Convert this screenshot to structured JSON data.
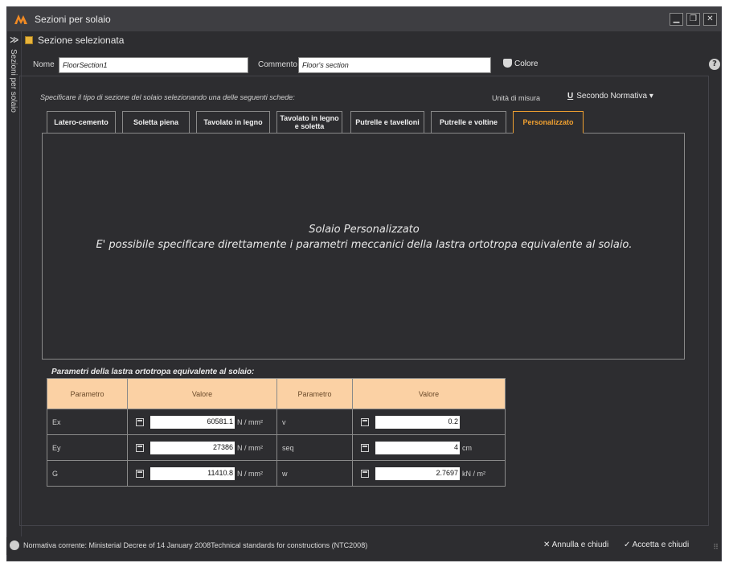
{
  "window": {
    "title": "Sezioni per solaio",
    "minimize": "▁",
    "restore": "❐",
    "close": "✕"
  },
  "sidebar": {
    "label": "Sezioni per solaio",
    "chevron": "≫"
  },
  "section": {
    "title": "Sezione selezionata",
    "name_label": "Nome",
    "name_value": "FloorSection1",
    "comment_label": "Commento",
    "comment_value": "Floor's section",
    "color_label": "Colore",
    "help": "?"
  },
  "instructions": "Specificare il tipo di sezione del solaio selezionando una delle seguenti schede:",
  "units": {
    "label": "Unità di misura",
    "icon_letter": "U",
    "value": "Secondo Normativa",
    "caret": "▾"
  },
  "tabs": [
    {
      "label": "Latero-cemento"
    },
    {
      "label": "Soletta piena"
    },
    {
      "label": "Tavolato in legno"
    },
    {
      "label": "Tavolato in legno e soletta"
    },
    {
      "label": "Putrelle e tavelloni"
    },
    {
      "label": "Putrelle e voltine"
    },
    {
      "label": "Personalizzato"
    }
  ],
  "active_tab": "Personalizzato",
  "custom": {
    "title": "Solaio Personalizzato",
    "description": "E' possibile specificare direttamente i parametri meccanici della lastra ortotropa equivalente al solaio."
  },
  "params": {
    "title": "Parametri della lastra ortotropa equivalente al solaio:",
    "headers": [
      "Parametro",
      "Valore",
      "Parametro",
      "Valore"
    ],
    "rows": [
      {
        "p1": "Ex",
        "v1": "60581.1",
        "u1": "N / mm²",
        "p2": "v",
        "v2": "0.2",
        "u2": ""
      },
      {
        "p1": "Ey",
        "v1": "27386",
        "u1": "N / mm²",
        "p2": "seq",
        "v2": "4",
        "u2": "cm"
      },
      {
        "p1": "G",
        "v1": "11410.8",
        "u1": "N / mm²",
        "p2": "w",
        "v2": "2.7697",
        "u2": "kN / m²"
      }
    ]
  },
  "status": {
    "text": "Normativa corrente:  Ministerial Decree of 14 January 2008Technical standards for constructions (NTC2008)",
    "cancel": "✕ Annulla e chiudi",
    "accept": "✓ Accetta e chiudi",
    "grip": "⠿"
  },
  "colors": {
    "accent": "#f0a030",
    "header_bg": "#fbd1a4",
    "window_bg": "#2d2d30"
  }
}
